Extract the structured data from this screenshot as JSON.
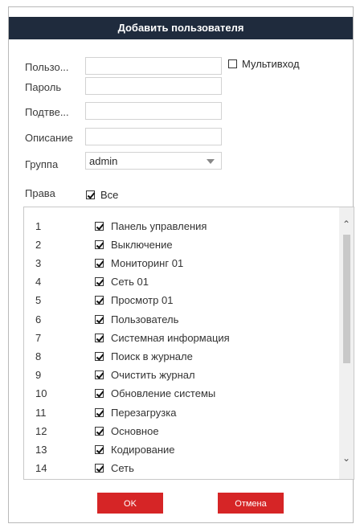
{
  "dialog": {
    "title": "Добавить пользователя"
  },
  "form": {
    "user_label": "Пользо...",
    "password_label": "Пароль",
    "confirm_label": "Подтве...",
    "description_label": "Описание",
    "group_label": "Группа",
    "group_value": "admin",
    "multi_login_label": "Мультивход",
    "multi_login_checked": false,
    "rights_label": "Права",
    "rights_all_label": "Все",
    "rights_all_checked": true
  },
  "permissions": [
    {
      "num": "1",
      "name": "Панель управления",
      "checked": true
    },
    {
      "num": "2",
      "name": "Выключение",
      "checked": true
    },
    {
      "num": "3",
      "name": "Мониторинг 01",
      "checked": true
    },
    {
      "num": "4",
      "name": "Сеть 01",
      "checked": true
    },
    {
      "num": "5",
      "name": "Просмотр 01",
      "checked": true
    },
    {
      "num": "6",
      "name": "Пользователь",
      "checked": true
    },
    {
      "num": "7",
      "name": "Системная информация",
      "checked": true
    },
    {
      "num": "8",
      "name": "Поиск в журнале",
      "checked": true
    },
    {
      "num": "9",
      "name": "Очистить журнал",
      "checked": true
    },
    {
      "num": "10",
      "name": "Обновление системы",
      "checked": true
    },
    {
      "num": "11",
      "name": "Перезагрузка",
      "checked": true
    },
    {
      "num": "12",
      "name": "Основное",
      "checked": true
    },
    {
      "num": "13",
      "name": "Кодирование",
      "checked": true
    },
    {
      "num": "14",
      "name": "Сеть",
      "checked": true
    }
  ],
  "buttons": {
    "ok": "OK",
    "cancel": "Отмена"
  },
  "colors": {
    "title_bg": "#1f2b3d",
    "button_red": "#d62526"
  },
  "icons": {
    "scroll_up": "chevron-up-icon",
    "scroll_down": "chevron-down-icon",
    "dropdown": "caret-down-icon"
  }
}
